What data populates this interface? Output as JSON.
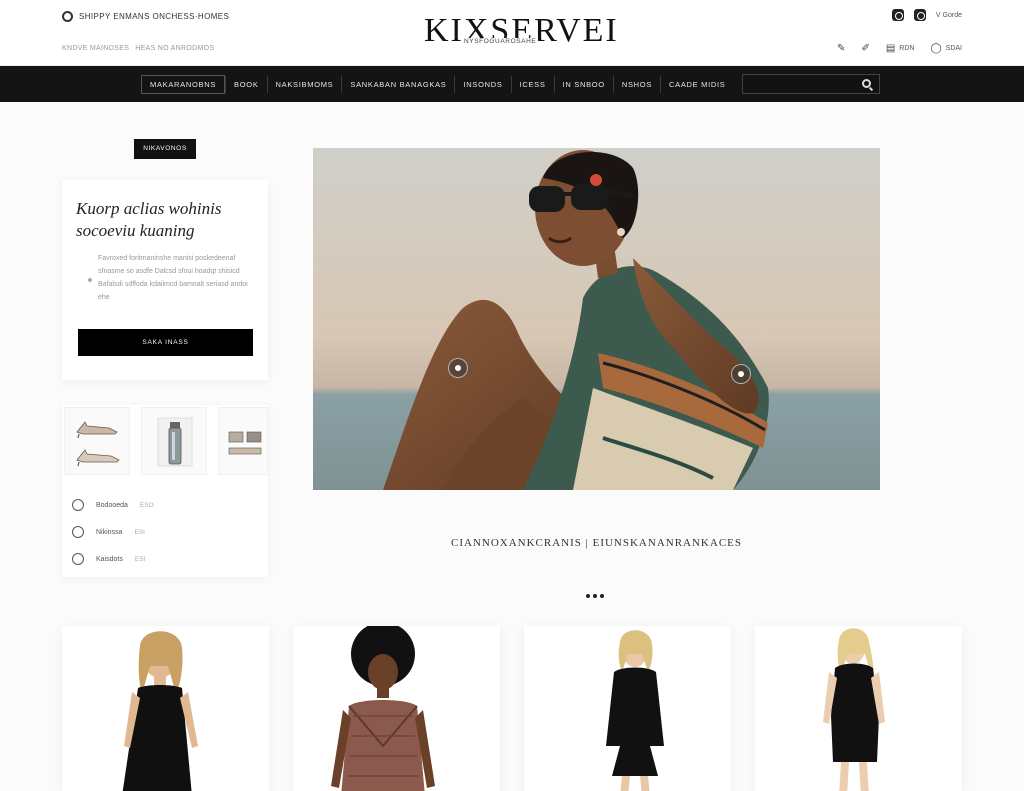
{
  "header": {
    "top_left_text": "SHIPPY ENMANS ONCHESS·HOMES",
    "top_sub_text": [
      "KNDVE MAINOSES",
      "HEAS NO ANRODMOS"
    ],
    "logo_text": "KIXSERVEI",
    "logo_tagline": "NYSFOGUAROSAHE",
    "top_right_label": "V Gorde",
    "util_items": [
      {
        "icon": "pencil-icon",
        "label": ""
      },
      {
        "icon": "pen-icon",
        "label": ""
      },
      {
        "icon": "bag-icon",
        "label": "RDN"
      },
      {
        "icon": "user-icon",
        "label": "SDAI"
      }
    ]
  },
  "nav": {
    "items": [
      "MAKARANOBNS",
      "BOOK",
      "NAKSIBMOMS",
      "SANKABAN BANAGKAS",
      "INSONDS",
      "ICESS",
      "IN SNBOO",
      "NSHOS",
      "CAADE MIDIS"
    ],
    "search_placeholder": ""
  },
  "promo": {
    "badge": "NIKAVONOS",
    "title": "Kuorp aclias wohinis socoeviu kuaning",
    "text": "Favroxed foritmaninshe manisi poskedeenaf sfnasme so asdfe Dalcsd sfoui hoadqt shisicd Bafalsdi sdffoda kdaiimcd bamoalt seriasd andoi ehe",
    "button": "SAKA INASS"
  },
  "features": [
    {
      "label": "Bodooeda",
      "value": "ESO"
    },
    {
      "label": "Nikinssa",
      "value": "ESI"
    },
    {
      "label": "Kaisdots",
      "value": "ESI"
    }
  ],
  "hero": {
    "tagline": "CIANNOXANKCRANIS | EIUNSKANANRANKACES"
  },
  "colors": {
    "nav_bg": "#141414",
    "accent": "#000000",
    "background": "#fbfbfb"
  }
}
